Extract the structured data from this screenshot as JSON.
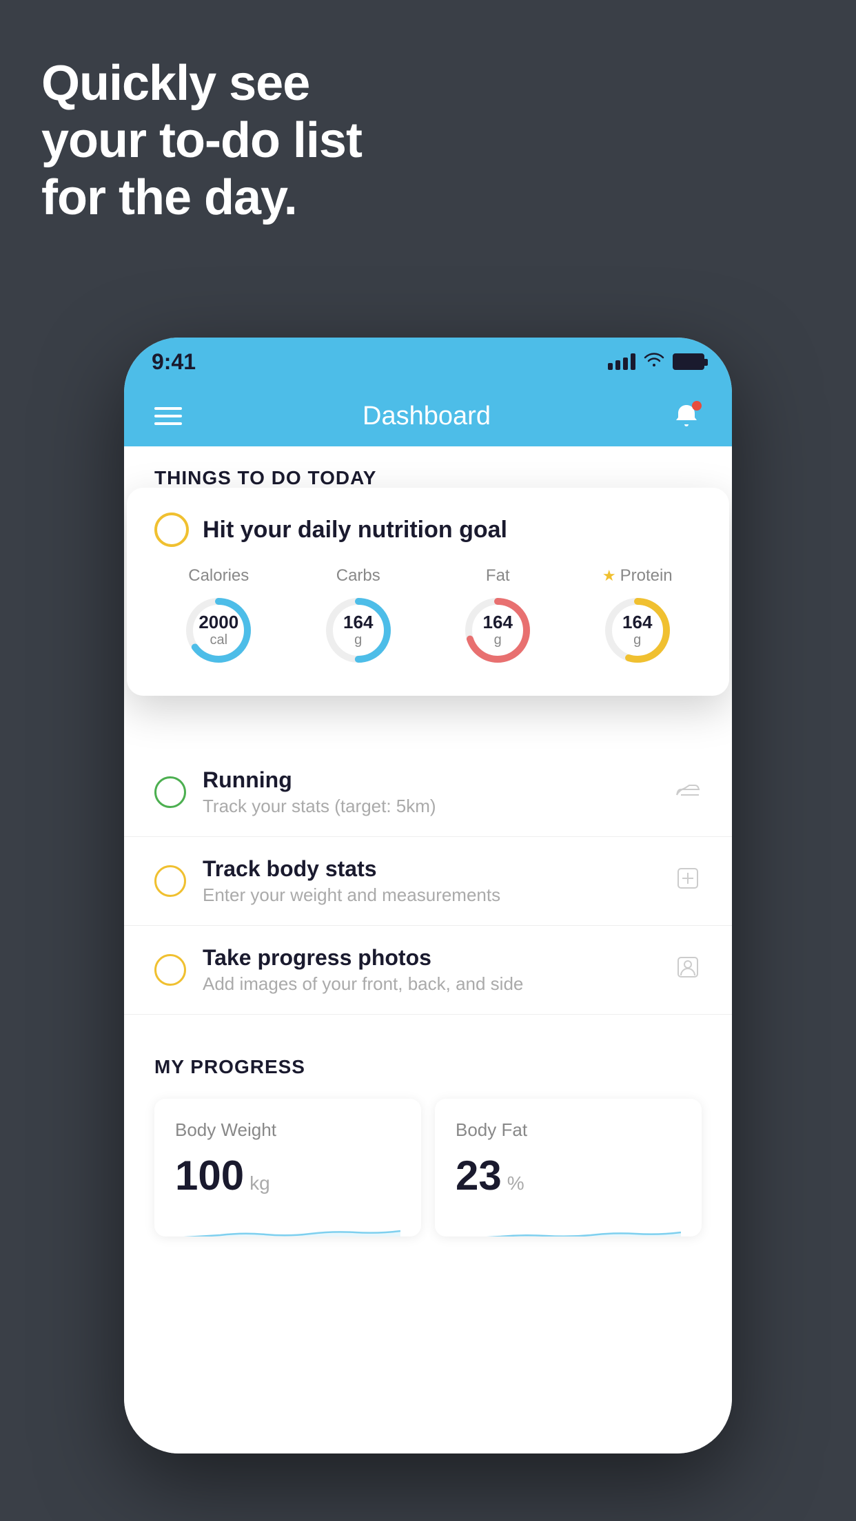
{
  "hero": {
    "title": "Quickly see\nyour to-do list\nfor the day."
  },
  "status_bar": {
    "time": "9:41"
  },
  "nav": {
    "title": "Dashboard"
  },
  "things_section": {
    "header": "THINGS TO DO TODAY"
  },
  "floating_card": {
    "task_title": "Hit your daily nutrition goal",
    "nutrition": [
      {
        "label": "Calories",
        "value": "2000",
        "unit": "cal",
        "color": "#4dbde8",
        "percent": 65,
        "starred": false
      },
      {
        "label": "Carbs",
        "value": "164",
        "unit": "g",
        "color": "#4dbde8",
        "percent": 50,
        "starred": false
      },
      {
        "label": "Fat",
        "value": "164",
        "unit": "g",
        "color": "#e87070",
        "percent": 70,
        "starred": false
      },
      {
        "label": "Protein",
        "value": "164",
        "unit": "g",
        "color": "#f0c030",
        "percent": 55,
        "starred": true
      }
    ]
  },
  "todo_items": [
    {
      "title": "Running",
      "subtitle": "Track your stats (target: 5km)",
      "circle_color": "green",
      "icon": "shoe"
    },
    {
      "title": "Track body stats",
      "subtitle": "Enter your weight and measurements",
      "circle_color": "yellow",
      "icon": "scale"
    },
    {
      "title": "Take progress photos",
      "subtitle": "Add images of your front, back, and side",
      "circle_color": "yellow",
      "icon": "person"
    }
  ],
  "progress_section": {
    "header": "MY PROGRESS",
    "cards": [
      {
        "title": "Body Weight",
        "value": "100",
        "unit": "kg"
      },
      {
        "title": "Body Fat",
        "value": "23",
        "unit": "%"
      }
    ]
  }
}
